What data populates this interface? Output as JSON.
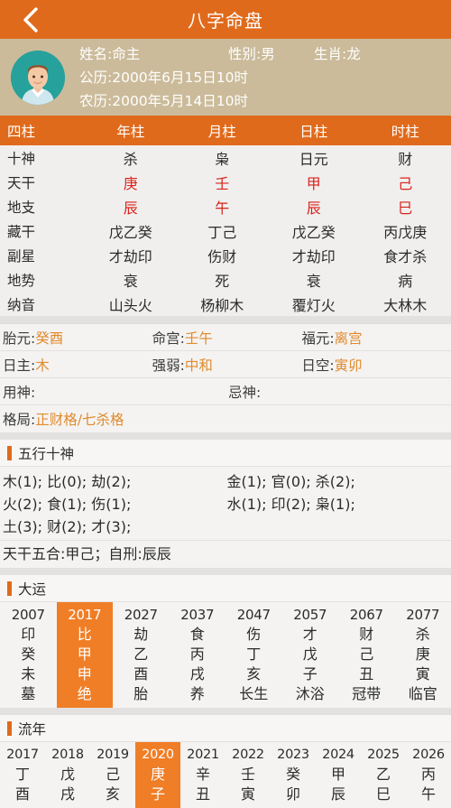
{
  "titlebar": {
    "title": "八字命盘",
    "back_icon": "chevron-left-icon"
  },
  "profile": {
    "avatar_icon": "user-avatar-icon",
    "name_label": "姓名:命主",
    "gender_label": "性别:男",
    "zodiac_label": "生肖:龙",
    "solar_label": "公历:2000年6月15日10时",
    "lunar_label": "农历:2000年5月14日10时"
  },
  "pillars": {
    "headers": [
      "四柱",
      "年柱",
      "月柱",
      "日柱",
      "时柱"
    ],
    "rows": [
      {
        "label": "十神",
        "values": [
          "杀",
          "枭",
          "日元",
          "财"
        ],
        "red": false
      },
      {
        "label": "天干",
        "values": [
          "庚",
          "壬",
          "甲",
          "己"
        ],
        "red": true
      },
      {
        "label": "地支",
        "values": [
          "辰",
          "午",
          "辰",
          "巳"
        ],
        "red": true
      },
      {
        "label": "藏干",
        "values": [
          "戊乙癸",
          "丁己",
          "戊乙癸",
          "丙戊庚"
        ],
        "red": false
      },
      {
        "label": "副星",
        "values": [
          "才劫印",
          "伤财",
          "才劫印",
          "食才杀"
        ],
        "red": false
      },
      {
        "label": "地势",
        "values": [
          "衰",
          "死",
          "衰",
          "病"
        ],
        "red": false
      },
      {
        "label": "纳音",
        "values": [
          "山头火",
          "杨柳木",
          "覆灯火",
          "大林木"
        ],
        "red": false
      }
    ]
  },
  "info": {
    "row1": [
      {
        "label": "胎元:",
        "value": "癸酉"
      },
      {
        "label": "命宫:",
        "value": "壬午"
      },
      {
        "label": "福元:",
        "value": "离宫"
      }
    ],
    "row2": [
      {
        "label": "日主:",
        "value": "木"
      },
      {
        "label": "强弱:",
        "value": "中和"
      },
      {
        "label": "日空:",
        "value": "寅卯"
      }
    ],
    "row3": [
      {
        "label": "用神:",
        "value": ""
      },
      {
        "label": "忌神:",
        "value": ""
      }
    ],
    "row4": [
      {
        "label": "格局:",
        "value": "正财格/七杀格"
      }
    ]
  },
  "wuxing": {
    "section_title": "五行十神",
    "left": [
      "木(1); 比(0); 劫(2);",
      "火(2); 食(1); 伤(1);",
      "土(3); 财(2); 才(3);"
    ],
    "right": [
      "金(1); 官(0); 杀(2);",
      "水(1); 印(2); 枭(1);"
    ],
    "footer": "天干五合:甲己；自刑:辰辰"
  },
  "dayun": {
    "section_title": "大运",
    "items": [
      {
        "year": "2007",
        "l1": "印",
        "l2": "癸",
        "l3": "未",
        "l4": "墓",
        "selected": false
      },
      {
        "year": "2017",
        "l1": "比",
        "l2": "甲",
        "l3": "申",
        "l4": "绝",
        "selected": true
      },
      {
        "year": "2027",
        "l1": "劫",
        "l2": "乙",
        "l3": "酉",
        "l4": "胎",
        "selected": false
      },
      {
        "year": "2037",
        "l1": "食",
        "l2": "丙",
        "l3": "戌",
        "l4": "养",
        "selected": false
      },
      {
        "year": "2047",
        "l1": "伤",
        "l2": "丁",
        "l3": "亥",
        "l4": "长生",
        "selected": false
      },
      {
        "year": "2057",
        "l1": "才",
        "l2": "戊",
        "l3": "子",
        "l4": "沐浴",
        "selected": false
      },
      {
        "year": "2067",
        "l1": "财",
        "l2": "己",
        "l3": "丑",
        "l4": "冠带",
        "selected": false
      },
      {
        "year": "2077",
        "l1": "杀",
        "l2": "庚",
        "l3": "寅",
        "l4": "临官",
        "selected": false
      }
    ]
  },
  "liunian": {
    "section_title": "流年",
    "items": [
      {
        "year": "2017",
        "l1": "丁",
        "l2": "酉",
        "selected": false
      },
      {
        "year": "2018",
        "l1": "戊",
        "l2": "戌",
        "selected": false
      },
      {
        "year": "2019",
        "l1": "己",
        "l2": "亥",
        "selected": false
      },
      {
        "year": "2020",
        "l1": "庚",
        "l2": "子",
        "selected": true
      },
      {
        "year": "2021",
        "l1": "辛",
        "l2": "丑",
        "selected": false
      },
      {
        "year": "2022",
        "l1": "壬",
        "l2": "寅",
        "selected": false
      },
      {
        "year": "2023",
        "l1": "癸",
        "l2": "卯",
        "selected": false
      },
      {
        "year": "2024",
        "l1": "甲",
        "l2": "辰",
        "selected": false
      },
      {
        "year": "2025",
        "l1": "乙",
        "l2": "巳",
        "selected": false
      },
      {
        "year": "2026",
        "l1": "丙",
        "l2": "午",
        "selected": false
      }
    ]
  },
  "colors": {
    "brand_orange": "#e06a1b",
    "selected_orange": "#f07e26",
    "profile_tan": "#cbbb9a",
    "stem_red": "#d9231b",
    "value_amber": "#e08b2d",
    "avatar_teal": "#27a19b"
  }
}
